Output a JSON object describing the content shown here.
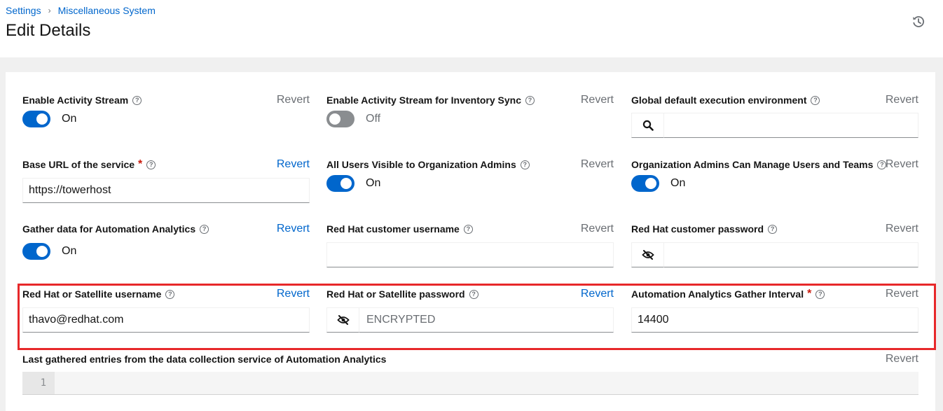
{
  "breadcrumb": {
    "root": "Settings",
    "separator": "›",
    "current": "Miscellaneous System"
  },
  "page": {
    "title": "Edit Details"
  },
  "icons": {
    "history": "history-icon",
    "help": "question-circle-icon",
    "search": "search-icon",
    "eye_slash": "eye-slash-icon"
  },
  "colors": {
    "accent": "#0066cc",
    "highlight_border": "#e7282a",
    "switch_off": "#8a8d90",
    "required": "#c9190b"
  },
  "common": {
    "revert": "Revert",
    "help_glyph": "?",
    "required_mark": "*"
  },
  "fields": {
    "activity_stream": {
      "label": "Enable Activity Stream",
      "state": "On"
    },
    "activity_stream_inventory": {
      "label": "Enable Activity Stream for Inventory Sync",
      "state": "Off"
    },
    "global_ee": {
      "label": "Global default execution environment",
      "value": ""
    },
    "base_url": {
      "label": "Base URL of the service",
      "value": "https://towerhost"
    },
    "users_visible": {
      "label": "All Users Visible to Organization Admins",
      "state": "On"
    },
    "org_admins_manage": {
      "label": "Organization Admins Can Manage Users and Teams",
      "state": "On"
    },
    "gather_analytics": {
      "label": "Gather data for Automation Analytics",
      "state": "On"
    },
    "rh_username": {
      "label": "Red Hat customer username",
      "value": ""
    },
    "rh_password": {
      "label": "Red Hat customer password",
      "value": ""
    },
    "sat_username": {
      "label": "Red Hat or Satellite username",
      "value": "thavo@redhat.com"
    },
    "sat_password": {
      "label": "Red Hat or Satellite password",
      "placeholder": "ENCRYPTED"
    },
    "gather_interval": {
      "label": "Automation Analytics Gather Interval",
      "value": "14400"
    },
    "last_gathered": {
      "label": "Last gathered entries from the data collection service of Automation Analytics",
      "line_number": "1"
    }
  }
}
